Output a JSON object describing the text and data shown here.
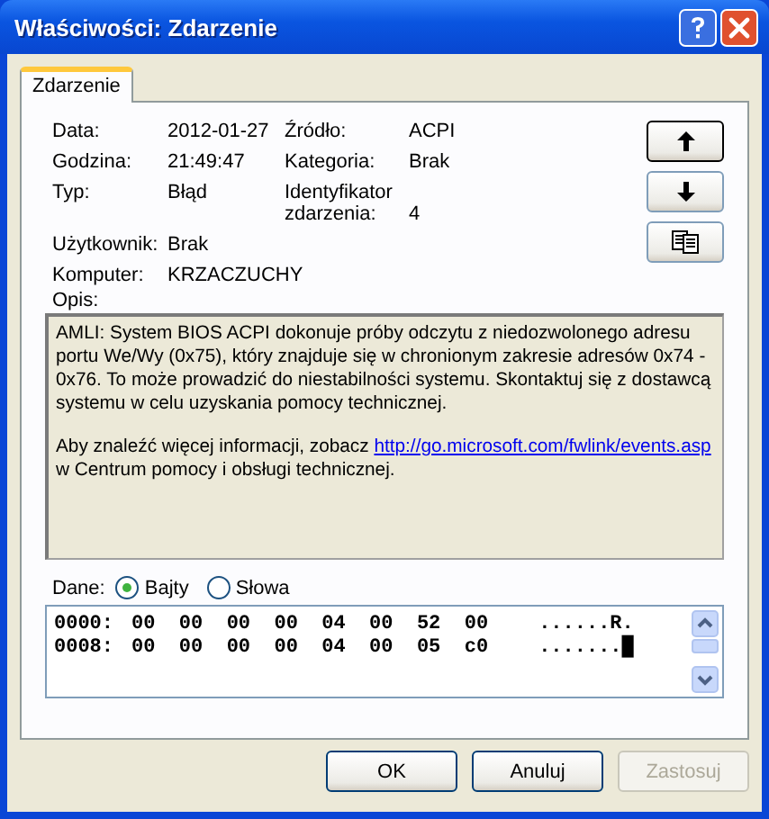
{
  "window": {
    "title": "Właściwości: Zdarzenie"
  },
  "tabs": [
    {
      "label": "Zdarzenie",
      "selected": true
    }
  ],
  "field_rows": [
    [
      {
        "label": "Data:",
        "value": "2012-01-27"
      },
      {
        "label": "Źródło:",
        "value": "ACPI"
      }
    ],
    [
      {
        "label": "Godzina:",
        "value": "21:49:47"
      },
      {
        "label": "Kategoria:",
        "value": "Brak"
      }
    ],
    [
      {
        "label": "Typ:",
        "value": "Błąd"
      },
      {
        "label": "Identyfikator zdarzenia:",
        "value": "4"
      }
    ],
    [
      {
        "label": "Użytkownik:",
        "value": "Brak"
      }
    ],
    [
      {
        "label": "Komputer:",
        "value": "KRZACZUCHY"
      }
    ]
  ],
  "description": {
    "label": "Opis:",
    "paragraphs": [
      {
        "text": "AMLI: System BIOS ACPI dokonuje próby odczytu z niedozwolonego adresu portu We/Wy (0x75), który znajduje się w chronionym zakresie adresów 0x74 - 0x76. To może prowadzić do niestabilności systemu. Skontaktuj się z dostawcą systemu w celu uzyskania pomocy technicznej."
      },
      {
        "text": "Aby znaleźć więcej informacji, zobacz",
        "link": "http://go.microsoft.com/fwlink/events.asp",
        "after": "w Centrum pomocy i obsługi technicznej."
      }
    ]
  },
  "data": {
    "label": "Dane:",
    "options": [
      {
        "label": "Bajty",
        "selected": true
      },
      {
        "label": "Słowa",
        "selected": false
      }
    ],
    "rows": [
      {
        "offset": "0000:",
        "bytes": [
          "00",
          "00",
          "00",
          "00",
          "04",
          "00",
          "52",
          "00"
        ],
        "ascii": "......R."
      },
      {
        "offset": "0008:",
        "bytes": [
          "00",
          "00",
          "00",
          "00",
          "04",
          "00",
          "05",
          "c0"
        ],
        "ascii": ".......█"
      }
    ]
  },
  "buttons": [
    {
      "label": "OK",
      "disabled": false
    },
    {
      "label": "Anuluj",
      "disabled": false
    },
    {
      "label": "Zastosuj",
      "disabled": true
    }
  ]
}
